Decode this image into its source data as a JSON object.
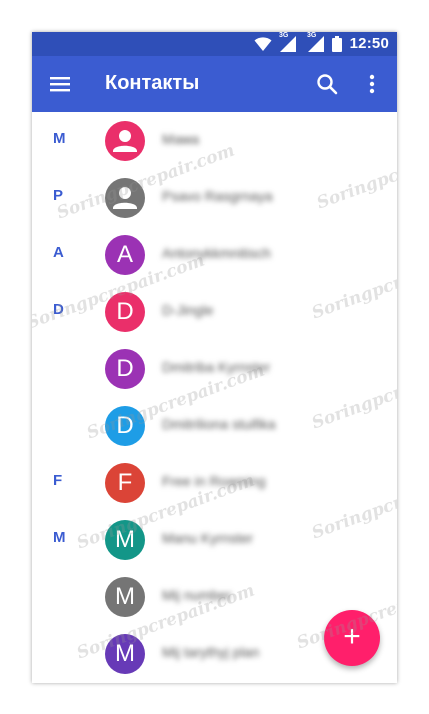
{
  "status_bar": {
    "time": "12:50",
    "network_1": "3G",
    "network_2": "3G",
    "icons": [
      "wifi-icon",
      "signal-icon",
      "signal-icon",
      "battery-icon"
    ]
  },
  "app_bar": {
    "title": "Контакты",
    "icons": [
      "menu-icon",
      "search-icon",
      "more-vert-icon"
    ]
  },
  "contacts": [
    {
      "section": "M",
      "initial": "",
      "avatar_icon": "person-icon",
      "color": "#ea2f6a",
      "name": "Мама"
    },
    {
      "section": "P",
      "initial": "",
      "avatar_icon": "person-icon",
      "color": "#757575",
      "name": "Psavo Rasgrnaya"
    },
    {
      "section": "A",
      "initial": "A",
      "avatar_icon": "",
      "color": "#9b32b4",
      "name": "Antonykkmnitisch"
    },
    {
      "section": "D",
      "initial": "D",
      "avatar_icon": "",
      "color": "#ea2f6a",
      "name": "D-Jingle"
    },
    {
      "section": "",
      "initial": "D",
      "avatar_icon": "",
      "color": "#9b32b4",
      "name": "Dmitriba Kyrnster"
    },
    {
      "section": "",
      "initial": "D",
      "avatar_icon": "",
      "color": "#1e9de6",
      "name": "Dmitriliona stuifika"
    },
    {
      "section": "F",
      "initial": "F",
      "avatar_icon": "",
      "color": "#db4437",
      "name": "Free in Roaming"
    },
    {
      "section": "M",
      "initial": "M",
      "avatar_icon": "",
      "color": "#139688",
      "name": "Manu Kyrnster"
    },
    {
      "section": "",
      "initial": "M",
      "avatar_icon": "",
      "color": "#757575",
      "name": "Mij number"
    },
    {
      "section": "",
      "initial": "M",
      "avatar_icon": "",
      "color": "#673ab7",
      "name": "Mij tarythyj plan"
    }
  ],
  "fab": {
    "label": "+",
    "icon": "add-icon",
    "color": "#ff1f6b"
  },
  "watermark_text": "Soringpcrepair.com"
}
